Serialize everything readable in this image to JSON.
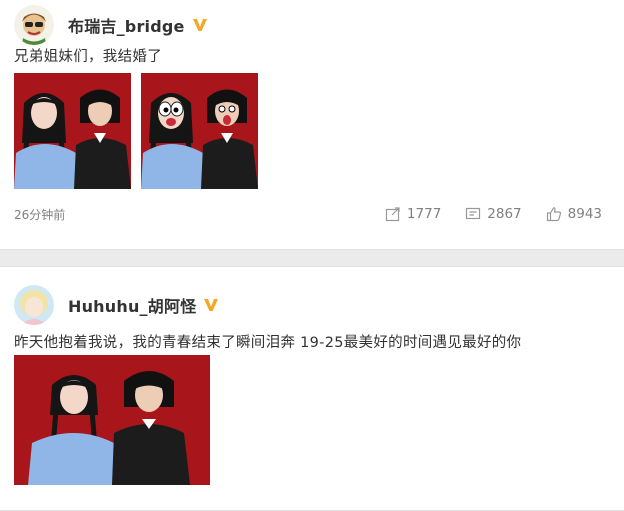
{
  "posts": [
    {
      "user": "布瑞吉_bridge",
      "text": "兄弟姐妹们，我结婚了",
      "timestamp": "26分钟前",
      "reposts": "1777",
      "comments": "2867",
      "likes": "8943",
      "verified_color": "#f5a623"
    },
    {
      "user": "Huhuhu_胡阿怪",
      "text": "昨天他抱着我说，我的青春结束了瞬间泪奔 19-25最美好的时间遇见最好的你",
      "verified_color": "#f5a623"
    }
  ],
  "icons": [
    "repost-icon",
    "comment-icon",
    "like-icon",
    "verified-badge-icon"
  ],
  "colors": {
    "photo_bg": "#a8161c",
    "muted": "#808080"
  }
}
